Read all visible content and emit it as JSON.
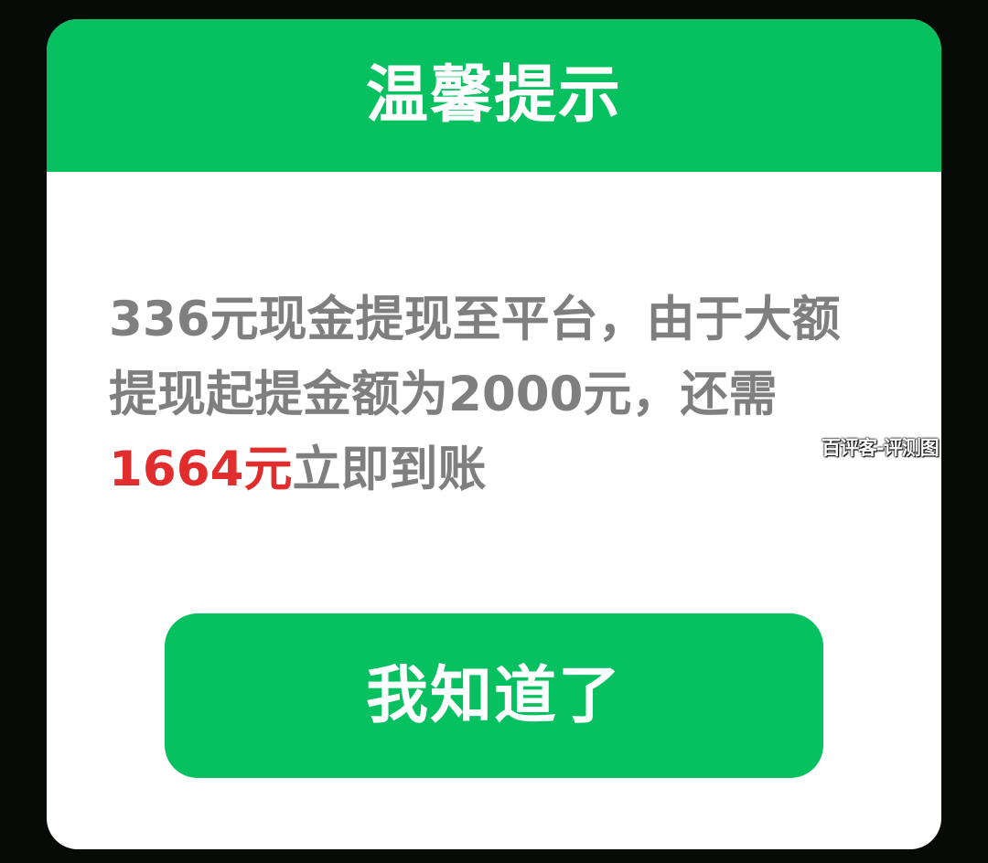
{
  "dialog": {
    "title": "温馨提示",
    "message": {
      "line1": "336元现金提现至平台，由于大额",
      "line2": "提现起提金额为2000元，还需",
      "line3_highlight": "1664元",
      "line3_rest": "立即到账"
    },
    "button_label": "我知道了"
  },
  "watermark": "百评客-评测图",
  "colors": {
    "background": "#070b07",
    "accent_green": "#07c160",
    "message_gray": "#7f7f7f",
    "highlight_red": "#e12d2d",
    "dialog_white": "#ffffff"
  }
}
